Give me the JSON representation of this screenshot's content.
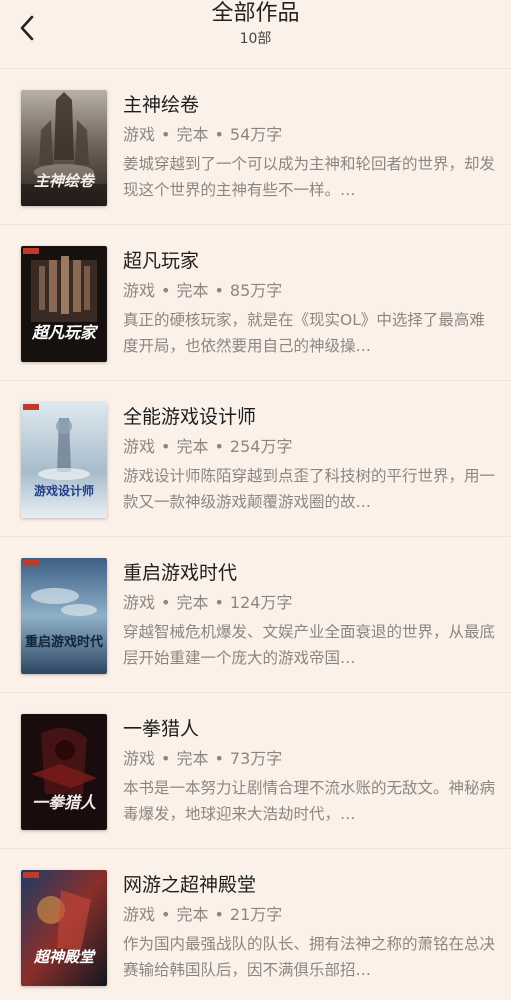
{
  "header": {
    "title": "全部作品",
    "subtitle": "10部"
  },
  "icons": {
    "back": "chevron-left-icon"
  },
  "colors": {
    "background": "#fbf1e9",
    "title": "#1e1e1e",
    "secondary": "#8c8682"
  },
  "books": [
    {
      "title": "主神绘卷",
      "genre": "游戏",
      "status": "完本",
      "words": "54万字",
      "desc": "姜城穿越到了一个可以成为主神和轮回者的世界，却发现这个世界的主神有些不一样。…",
      "cover_text": "主神绘卷"
    },
    {
      "title": "超凡玩家",
      "genre": "游戏",
      "status": "完本",
      "words": "85万字",
      "desc": "真正的硬核玩家，就是在《现实OL》中选择了最高难度开局，也依然要用自己的神级操…",
      "cover_text": "超凡玩家"
    },
    {
      "title": "全能游戏设计师",
      "genre": "游戏",
      "status": "完本",
      "words": "254万字",
      "desc": "游戏设计师陈陌穿越到点歪了科技树的平行世界，用一款又一款神级游戏颠覆游戏圈的故…",
      "cover_text": "游戏设计师"
    },
    {
      "title": "重启游戏时代",
      "genre": "游戏",
      "status": "完本",
      "words": "124万字",
      "desc": "穿越智械危机爆发、文娱产业全面衰退的世界，从最底层开始重建一个庞大的游戏帝国…",
      "cover_text": "重启游戏时代"
    },
    {
      "title": "一拳猎人",
      "genre": "游戏",
      "status": "完本",
      "words": "73万字",
      "desc": "本书是一本努力让剧情合理不流水账的无敌文。神秘病毒爆发，地球迎来大浩劫时代，…",
      "cover_text": "一拳猎人"
    },
    {
      "title": "网游之超神殿堂",
      "genre": "游戏",
      "status": "完本",
      "words": "21万字",
      "desc": "作为国内最强战队的队长、拥有法神之称的萧铭在总决赛输给韩国队后，因不满俱乐部招…",
      "cover_text": "超神殿堂"
    }
  ]
}
